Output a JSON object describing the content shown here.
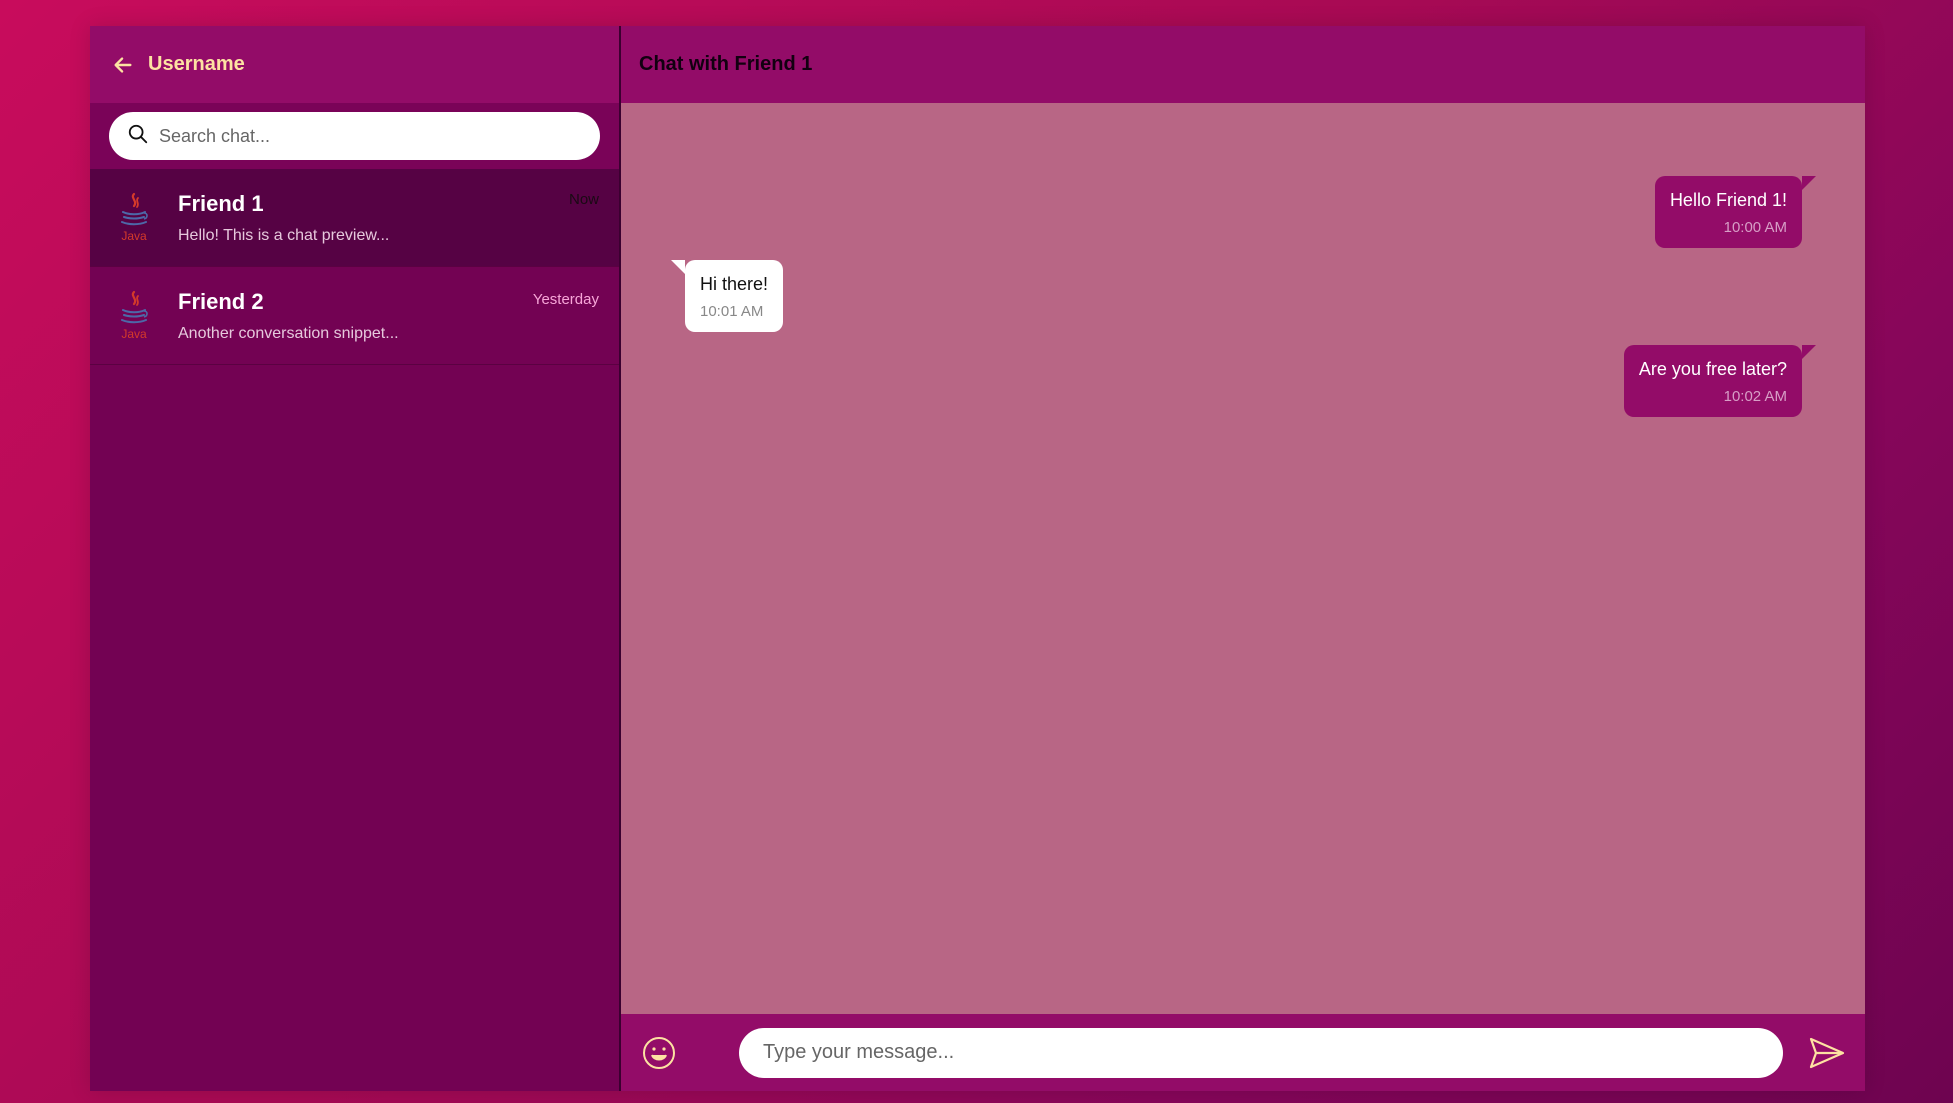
{
  "sidebar": {
    "username": "Username",
    "search": {
      "placeholder": "Search chat...",
      "value": ""
    },
    "chats": [
      {
        "name": "Friend 1",
        "preview": "Hello! This is a chat preview...",
        "time": "Now",
        "active": true
      },
      {
        "name": "Friend 2",
        "preview": "Another conversation snippet...",
        "time": "Yesterday",
        "active": false
      }
    ]
  },
  "main": {
    "title": "Chat with Friend 1",
    "messages": [
      {
        "direction": "out",
        "text": "Hello Friend 1!",
        "time": "10:00 AM"
      },
      {
        "direction": "in",
        "text": "Hi there!",
        "time": "10:01 AM"
      },
      {
        "direction": "out",
        "text": "Are you free later?",
        "time": "10:02 AM"
      }
    ],
    "composer": {
      "placeholder": "Type your message...",
      "value": ""
    }
  },
  "colors": {
    "accent": "#930c68",
    "sidebar_bg": "#730253",
    "active_chat_bg": "#560244",
    "chat_area_bg": "#b86685",
    "username_color": "#fde2a2"
  },
  "icons": {
    "back": "arrow-left-icon",
    "search": "search-icon",
    "avatar": "java-logo-icon",
    "emoji": "smiley-icon",
    "send": "send-icon"
  }
}
